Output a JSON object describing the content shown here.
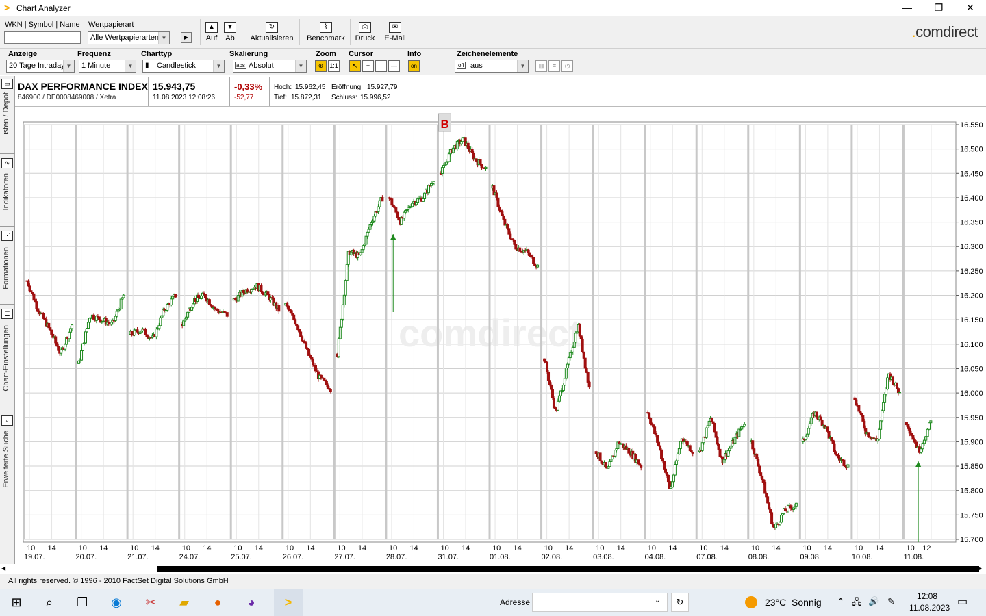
{
  "window": {
    "title": "Chart Analyzer",
    "minimize": "—",
    "restore": "❐",
    "close": "✕"
  },
  "brand": {
    "pre": ".",
    "name": "comdirect"
  },
  "toolbar1": {
    "search_label": "WKN | Symbol | Name",
    "search_value": "",
    "type_label": "Wertpapierart",
    "type_value": "Alle Wertpapierarten",
    "go_icon": "play-icon",
    "up_label": "Auf",
    "down_label": "Ab",
    "refresh_label": "Aktualisieren",
    "benchmark_label": "Benchmark",
    "print_label": "Druck",
    "email_label": "E-Mail"
  },
  "toolbar2": {
    "anzeige_label": "Anzeige",
    "anzeige_value": "20 Tage Intraday",
    "frequenz_label": "Frequenz",
    "frequenz_value": "1 Minute",
    "charttyp_label": "Charttyp",
    "charttyp_value": "Candlestick",
    "skalierung_label": "Skalierung",
    "skalierung_value": "Absolut",
    "skalierung_tag": "abs",
    "zoom_label": "Zoom",
    "zoom_btn2": "1:1",
    "cursor_label": "Cursor",
    "info_label": "Info",
    "info_btn": "on",
    "zeichen_label": "Zeichenelemente",
    "zeichen_value": "aus",
    "zeichen_tag": "off"
  },
  "sidebar": {
    "tabs": [
      "Listen / Depot",
      "Indikatoren",
      "Formationen",
      "Chart-Einstellungen",
      "Erweiterte Suche"
    ]
  },
  "instrument": {
    "name": "DAX PERFORMANCE INDEX",
    "ids": "846900 / DE0008469008 / Xetra",
    "price": "15.943,75",
    "datetime": "11.08.2023 12:08:26",
    "change_pct": "-0,33%",
    "change_abs": "-52,77",
    "hoch_label": "Hoch:",
    "hoch": "15.962,45",
    "eroeffnung_label": "Eröffnung:",
    "eroeffnung": "15.927,79",
    "tief_label": "Tief:",
    "tief": "15.872,31",
    "schluss_label": "Schluss:",
    "schluss": "15.996,52",
    "marker": "B"
  },
  "watermark": "comdirect",
  "chart_data": {
    "type": "line",
    "subtype": "candlestick-intraday",
    "ylim": [
      15700,
      16550
    ],
    "yticks": [
      "16.550",
      "16.500",
      "16.450",
      "16.400",
      "16.350",
      "16.300",
      "16.250",
      "16.200",
      "16.150",
      "16.100",
      "16.050",
      "16.000",
      "15.950",
      "15.900",
      "15.850",
      "15.800",
      "15.750",
      "15.700"
    ],
    "days": [
      "19.07.",
      "20.07.",
      "21.07.",
      "24.07.",
      "25.07.",
      "26.07.",
      "27.07.",
      "28.07.",
      "31.07.",
      "01.08.",
      "02.08.",
      "03.08.",
      "04.08.",
      "07.08.",
      "08.08.",
      "09.08.",
      "10.08.",
      "11.08."
    ],
    "hour_ticks": [
      "10",
      "14"
    ],
    "last_day_extra_tick": "12",
    "days_approx_close": [
      [
        16230,
        16170,
        16130,
        16080,
        16140
      ],
      [
        16060,
        16160,
        16150,
        16140,
        16200
      ],
      [
        16120,
        16130,
        16110,
        16170,
        16200
      ],
      [
        16140,
        16190,
        16200,
        16170,
        16160
      ],
      [
        16190,
        16210,
        16220,
        16200,
        16170
      ],
      [
        16180,
        16140,
        16080,
        16030,
        16010
      ],
      [
        16080,
        16290,
        16280,
        16350,
        16400
      ],
      [
        16400,
        16350,
        16390,
        16400,
        16440
      ],
      [
        16450,
        16500,
        16520,
        16480,
        16460
      ],
      [
        16420,
        16350,
        16300,
        16290,
        16260
      ],
      [
        16070,
        15960,
        16050,
        16140,
        16010
      ],
      [
        15880,
        15840,
        15900,
        15880,
        15850
      ],
      [
        15960,
        15890,
        15800,
        15910,
        15880
      ],
      [
        15880,
        15950,
        15860,
        15900,
        15940
      ],
      [
        15900,
        15820,
        15720,
        15760,
        15770
      ],
      [
        15900,
        15960,
        15930,
        15870,
        15850
      ],
      [
        15990,
        15920,
        15900,
        16040,
        16000
      ],
      [
        15940,
        15880,
        15940
      ]
    ],
    "arrows_up": [
      {
        "day": 7,
        "pos": 0.15
      },
      {
        "day": 17,
        "pos": 0.3
      }
    ],
    "colors": {
      "up": "#1f8a1f",
      "down": "#a01010",
      "grid": "#d0d0d0",
      "dayline": "#c8c8c8"
    }
  },
  "footer": {
    "copyright": "All rights reserved. © 1996 - 2010 FactSet Digital Solutions GmbH"
  },
  "taskbar": {
    "address_label": "Adresse",
    "address_value": "",
    "weather": "23°C  Sonnig",
    "time": "12:08",
    "date": "11.08.2023"
  }
}
